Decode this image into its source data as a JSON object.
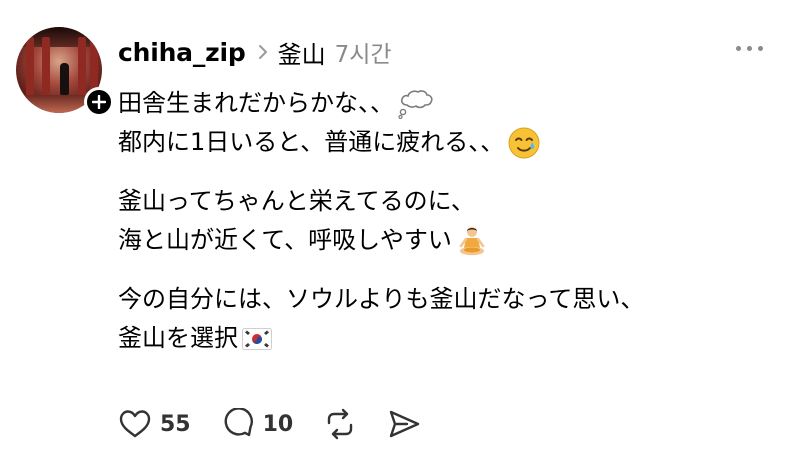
{
  "post": {
    "username": "chiha_zip",
    "location": "釜山",
    "time_ago": "7시간",
    "paragraphs": [
      {
        "lines": [
          {
            "text": "田舎生まれだからかな、、",
            "emoji": "thought-bubble-icon"
          },
          {
            "text": "都内に1日いると、普通に疲れる、、",
            "emoji": "smiling-face-with-tear-icon"
          }
        ]
      },
      {
        "lines": [
          {
            "text": "釜山ってちゃんと栄えてるのに、",
            "emoji": null
          },
          {
            "text": "海と山が近くて、呼吸しやすい",
            "emoji": "person-in-lotus-position-icon"
          }
        ]
      },
      {
        "lines": [
          {
            "text": "今の自分には、ソウルよりも釜山だなって思い、",
            "emoji": null
          },
          {
            "text": "釜山を選択",
            "emoji": "south-korea-flag-icon"
          }
        ]
      }
    ]
  },
  "actions": {
    "likes": "55",
    "comments": "10"
  },
  "colors": {
    "text": "#000000",
    "muted": "#8a8a8a",
    "count": "#333333"
  }
}
